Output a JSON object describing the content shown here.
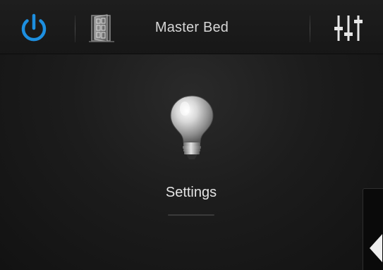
{
  "header": {
    "room_title": "Master Bed",
    "icons": {
      "power": "power-icon",
      "room": "door-icon",
      "settings": "sliders-icon"
    }
  },
  "main": {
    "scene_label": "Settings",
    "scene_icon": "light-bulb-icon"
  },
  "side_panel": {
    "toggle_icon": "chevron-left-icon"
  },
  "colors": {
    "accent": "#1d8fe0",
    "background": "#1a1a1a",
    "text": "#d6d6d6"
  }
}
